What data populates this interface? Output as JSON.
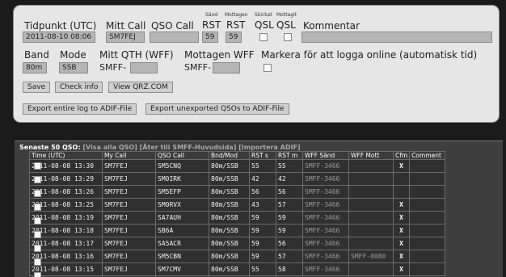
{
  "form": {
    "labels": {
      "tidpunkt": "Tidpunkt (UTC)",
      "mitt_call": "Mitt Call",
      "qso_call": "QSO Call",
      "rst_sand_small": "Sänd",
      "rst_sand": "RST",
      "rst_mott_small": "Mottagen",
      "rst_mott": "RST",
      "qsl_skickat_small": "Skickat",
      "qsl_skickat": "QSL",
      "qsl_mottagit_small": "Mottagit",
      "qsl_mottagit": "QSL",
      "kommentar": "Kommentar",
      "band": "Band",
      "mode": "Mode",
      "mitt_qth": "Mitt QTH (WFF)",
      "mottagen_wff": "Mottagen WFF",
      "markera": "Markera för att logga online (automatisk tid)"
    },
    "values": {
      "tidpunkt": "2011-08-10 08:06",
      "mitt_call": "SM7FEJ",
      "qso_call": "",
      "rst_sand": "59",
      "rst_mott": "59",
      "kommentar": "",
      "band": "80m",
      "mode": "SSB",
      "mitt_qth_prefix": "SMFF-",
      "mitt_qth": "",
      "mottagen_wff_prefix": "SMFF-",
      "mottagen_wff": ""
    },
    "buttons": {
      "save": "Save",
      "check_info": "Check info",
      "view_qrz": "View QRZ.COM",
      "export_all": "Export entire log to ADIF-File",
      "export_unexported": "Export unexported QSOs to ADIF-File"
    }
  },
  "qso_list": {
    "title": "Senaste 50 QSO:",
    "link_all": "[Visa alla QSO]",
    "link_back": "[Åter till SMFF-Huvudsida]",
    "link_import": "[Importera ADIF]",
    "columns": [
      "Time (UTC)",
      "My Call",
      "QSO Call",
      "Bnd/Mod",
      "RST s",
      "RST m",
      "WFF Sänd",
      "WFF Mott",
      "Cfm",
      "Comment"
    ],
    "rows": [
      {
        "time": "2011-08-08 13:30",
        "my_call": "SM7FEJ",
        "qso_call": "SM5CNQ",
        "bnd_mod": "80m/SSB",
        "rst_s": "55",
        "rst_m": "55",
        "wff_s": "SMFF-3466",
        "wff_m": "",
        "cfm": "X",
        "comment": ""
      },
      {
        "time": "2011-08-08 13:29",
        "my_call": "SM7FEJ",
        "qso_call": "SM0IRK",
        "bnd_mod": "80m/SSB",
        "rst_s": "42",
        "rst_m": "42",
        "wff_s": "SMFF-3466",
        "wff_m": "",
        "cfm": "",
        "comment": ""
      },
      {
        "time": "2011-08-08 13:26",
        "my_call": "SM7FEJ",
        "qso_call": "SM5EFP",
        "bnd_mod": "80m/SSB",
        "rst_s": "56",
        "rst_m": "56",
        "wff_s": "SMFF-3466",
        "wff_m": "",
        "cfm": "",
        "comment": ""
      },
      {
        "time": "2011-08-08 13:25",
        "my_call": "SM7FEJ",
        "qso_call": "SM0RVX",
        "bnd_mod": "80m/SSB",
        "rst_s": "43",
        "rst_m": "57",
        "wff_s": "SMFF-3466",
        "wff_m": "",
        "cfm": "X",
        "comment": ""
      },
      {
        "time": "2011-08-08 13:19",
        "my_call": "SM7FEJ",
        "qso_call": "SA7AUH",
        "bnd_mod": "80m/SSB",
        "rst_s": "59",
        "rst_m": "59",
        "wff_s": "SMFF-3466",
        "wff_m": "",
        "cfm": "X",
        "comment": ""
      },
      {
        "time": "2011-08-08 13:18",
        "my_call": "SM7FEJ",
        "qso_call": "SB6A",
        "bnd_mod": "80m/SSB",
        "rst_s": "59",
        "rst_m": "59",
        "wff_s": "SMFF-3466",
        "wff_m": "",
        "cfm": "X",
        "comment": ""
      },
      {
        "time": "2011-08-08 13:17",
        "my_call": "SM7FEJ",
        "qso_call": "SA5ACR",
        "bnd_mod": "80m/SSB",
        "rst_s": "59",
        "rst_m": "56",
        "wff_s": "SMFF-3466",
        "wff_m": "",
        "cfm": "X",
        "comment": ""
      },
      {
        "time": "2011-08-08 13:16",
        "my_call": "SM7FEJ",
        "qso_call": "SM5CBN",
        "bnd_mod": "80m/SSB",
        "rst_s": "59",
        "rst_m": "57",
        "wff_s": "SMFF-3466",
        "wff_m": "SMFF-0080",
        "cfm": "X",
        "comment": ""
      },
      {
        "time": "2011-08-08 13:15",
        "my_call": "SM7FEJ",
        "qso_call": "SM7CMV",
        "bnd_mod": "80m/SSB",
        "rst_s": "55",
        "rst_m": "58",
        "wff_s": "SMFF-3466",
        "wff_m": "",
        "cfm": "X",
        "comment": ""
      }
    ]
  }
}
